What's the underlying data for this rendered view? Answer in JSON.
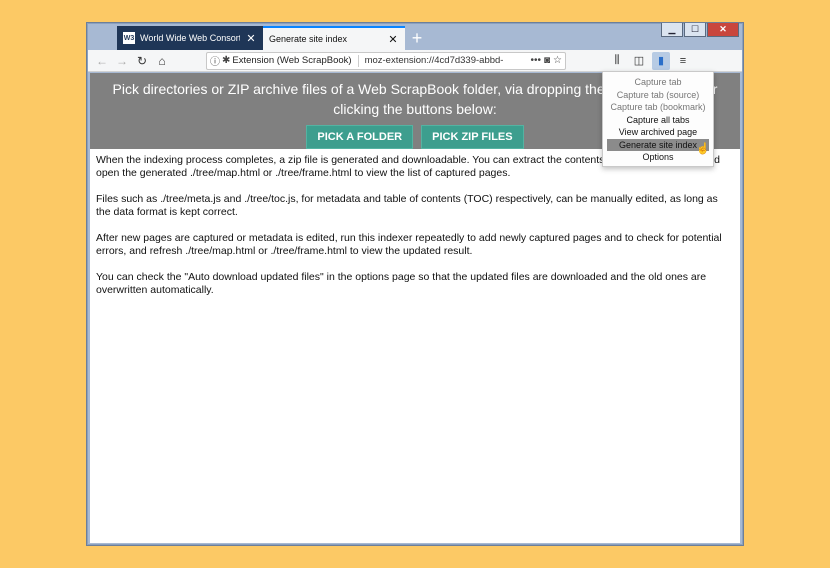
{
  "window_controls": {
    "minimize": "▁",
    "maximize": "☐",
    "close": "✕"
  },
  "tabs": [
    {
      "favicon": "W3",
      "title": "World Wide Web Consortium",
      "close": "✕"
    },
    {
      "title": "Generate site index",
      "close": "✕"
    }
  ],
  "new_tab": "+",
  "nav": {
    "back": "←",
    "forward": "→",
    "reload": "↻",
    "home": "⌂"
  },
  "urlbar": {
    "identity": "Extension (Web ScrapBook)",
    "url": "moz-extension://4cd7d339-abbd-",
    "more": "•••"
  },
  "toolbar_icons": [
    "library-icon",
    "sidebar-icon",
    "scrapbook-icon",
    "menu-icon"
  ],
  "banner": {
    "text": "Pick directories or ZIP archive files of a Web ScrapBook folder, via dropping them into the page or clicking the buttons below:",
    "pick_folder": "PICK A FOLDER",
    "pick_zip": "PICK ZIP FILES"
  },
  "paragraphs": [
    "When the indexing process completes, a zip file is generated and downloadable. You can extract the contents to the original folder and open the generated ./tree/map.html or ./tree/frame.html to view the list of captured pages.",
    "Files such as ./tree/meta.js and ./tree/toc.js, for metadata and table of contents (TOC) respectively, can be manually edited, as long as the data format is kept correct.",
    "After new pages are captured or metadata is edited, run this indexer repeatedly to add newly captured pages and to check for potential errors, and refresh ./tree/map.html or ./tree/frame.html to view the updated result.",
    "You can check the \"Auto download updated files\" in the options page so that the updated files are downloaded and the old ones are overwritten automatically."
  ],
  "popup_menu": [
    {
      "label": "Capture tab",
      "state": "disabled"
    },
    {
      "label": "Capture tab (source)",
      "state": "disabled"
    },
    {
      "label": "Capture tab (bookmark)",
      "state": "disabled"
    },
    {
      "label": "Capture all tabs",
      "state": "enabled"
    },
    {
      "label": "View archived page",
      "state": "enabled"
    },
    {
      "label": "Generate site index",
      "state": "highlighted"
    },
    {
      "label": "Options",
      "state": "enabled"
    }
  ],
  "colors": {
    "desktop": "#fcc965",
    "banner": "#808080",
    "button": "#3d9e8e",
    "tab_inactive": "#1f3657"
  }
}
